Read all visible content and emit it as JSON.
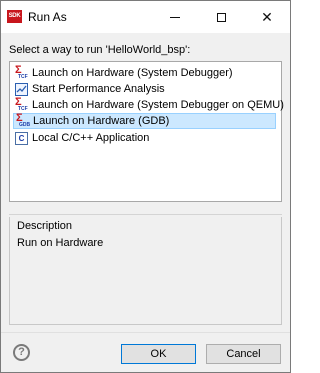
{
  "window": {
    "title": "Run As",
    "app_icon_text": "SDK",
    "minimize_icon": "minimize-icon",
    "maximize_icon": "maximize-icon",
    "close_icon": "close-icon"
  },
  "prompt": "Select a way to run 'HelloWorld_bsp':",
  "launch_options": [
    {
      "label": "Launch on Hardware (System Debugger)",
      "icon": "tcf-launch-icon",
      "selected": false
    },
    {
      "label": "Start Performance Analysis",
      "icon": "performance-chart-icon",
      "selected": false
    },
    {
      "label": "Launch on Hardware (System Debugger on QEMU)",
      "icon": "tcf-launch-icon",
      "selected": false
    },
    {
      "label": "Launch on Hardware (GDB)",
      "icon": "gdb-launch-icon",
      "selected": true
    },
    {
      "label": "Local C/C++ Application",
      "icon": "c-application-icon",
      "selected": false
    }
  ],
  "icon_text": {
    "tcf": "TCF",
    "gdb": "GDB",
    "c": "C"
  },
  "description": {
    "title": "Description",
    "text": "Run on Hardware"
  },
  "buttons": {
    "help": "?",
    "ok": "OK",
    "cancel": "Cancel"
  },
  "colors": {
    "selection": "#cce8ff",
    "selection_border": "#99d1ff",
    "default_button_border": "#0078d7",
    "sdk_icon": "#c8161d"
  }
}
